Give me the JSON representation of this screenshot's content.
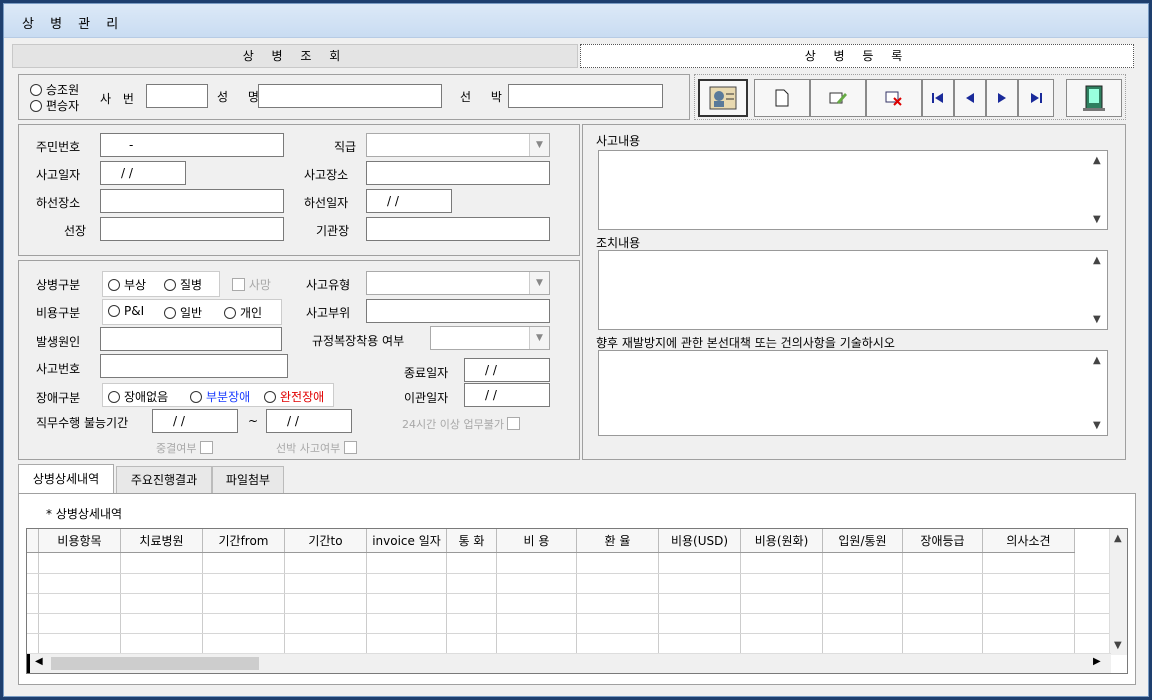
{
  "window": {
    "title": "상 병 관 리"
  },
  "tabs": {
    "inquiry": "상 병 조 회",
    "register": "상 병 등 록"
  },
  "search": {
    "radio_crew": "승조원",
    "radio_edit": "편승자",
    "emp_no_label": "사 번",
    "name_label": "성 명",
    "ship_label": "선 박"
  },
  "toolbar": {
    "icons": [
      "crew-card-icon",
      "new-document-icon",
      "edit-icon",
      "delete-icon",
      "first-record-icon",
      "prev-record-icon",
      "next-record-icon",
      "last-record-icon",
      "exit-door-icon"
    ]
  },
  "basic": {
    "resident_label": "주민번호",
    "resident_value": "-",
    "rank_label": "직급",
    "accident_date_label": "사고일자",
    "accident_date_value": "/ /",
    "accident_place_label": "사고장소",
    "disembark_place_label": "하선장소",
    "disembark_date_label": "하선일자",
    "disembark_date_value": "/ /",
    "captain_label": "선장",
    "chief_engineer_label": "기관장"
  },
  "detail": {
    "type_label": "상병구분",
    "type_injury": "부상",
    "type_disease": "질병",
    "type_death": "사망",
    "accident_type_label": "사고유형",
    "cost_label": "비용구분",
    "cost_pi": "P&I",
    "cost_general": "일반",
    "cost_personal": "개인",
    "accident_part_label": "사고부위",
    "cause_label": "발생원인",
    "rule_label": "규정복장착용 여부",
    "accident_no_label": "사고번호",
    "end_date_label": "종료일자",
    "end_date_value": "/ /",
    "transfer_date_label": "이관일자",
    "transfer_date_value": "/ /",
    "disability_label": "장애구분",
    "dis_none": "장애없음",
    "dis_partial": "부분장애",
    "dis_full": "완전장애",
    "unable_label": "직무수행 불능기간",
    "unable_from": "/ /",
    "tilde": "~",
    "unable_to": "/ /",
    "over_label": "24시간 이상 업무불가",
    "severe_label": "중결여부",
    "ship_accident_label": "선박 사고여부"
  },
  "right": {
    "accident_content_label": "사고내용",
    "action_content_label": "조치내용",
    "prevent_label": "향후 재발방지에 관한 본선대책 또는 건의사항을 기술하시오"
  },
  "bottom_tabs": [
    "상병상세내역",
    "주요진행결과",
    "파일첨부"
  ],
  "grid": {
    "caption": "* 상병상세내역",
    "columns": [
      "비용항목",
      "치료병원",
      "기간from",
      "기간to",
      "invoice 일자",
      "통 화",
      "비 용",
      "환 율",
      "비용(USD)",
      "비용(원화)",
      "입원/통원",
      "장애등급",
      "의사소견"
    ]
  },
  "colors": {
    "partial": "#1a3cff",
    "full": "#e00000"
  }
}
